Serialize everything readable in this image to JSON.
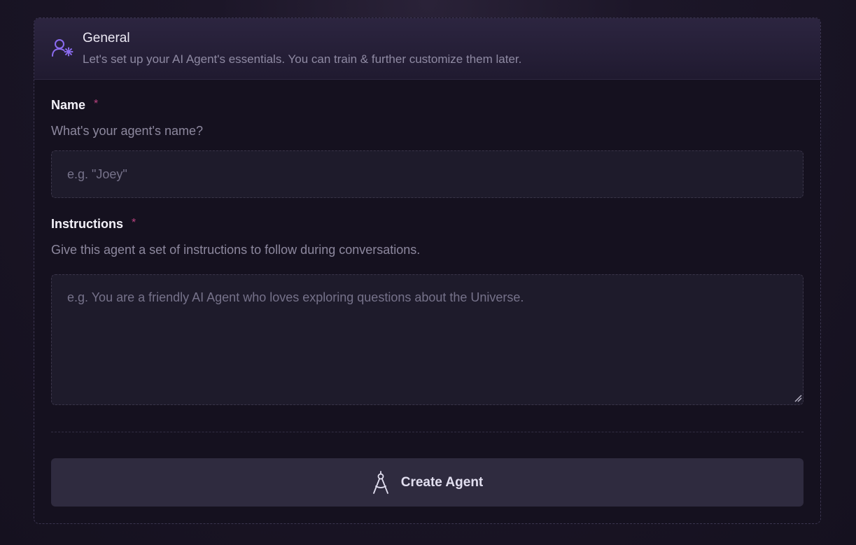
{
  "header": {
    "icon": "user-gear-icon",
    "title": "General",
    "subtitle": "Let's set up your AI Agent's essentials. You can train & further customize them later."
  },
  "fields": {
    "name": {
      "label": "Name",
      "required_marker": "*",
      "description": "What's your agent's name?",
      "placeholder": "e.g. \"Joey\"",
      "value": ""
    },
    "instructions": {
      "label": "Instructions",
      "required_marker": "*",
      "description": "Give this agent a set of instructions to follow during conversations.",
      "placeholder": "e.g. You are a friendly AI Agent who loves exploring questions about the Universe.",
      "value": ""
    }
  },
  "create_button": {
    "icon": "compass-drafting-icon",
    "label": "Create Agent"
  },
  "colors": {
    "accent": "#8b6cf0",
    "required": "#b8427f",
    "button_bg": "#2f2b3f"
  }
}
